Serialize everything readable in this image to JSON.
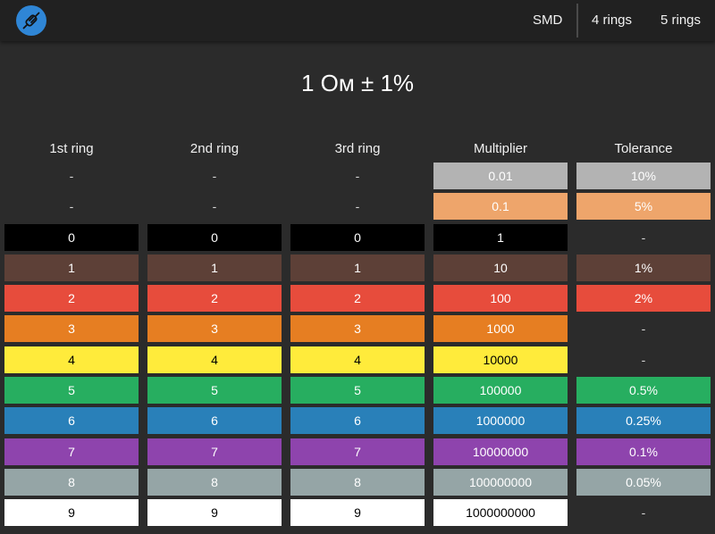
{
  "topbar": {
    "app_icon": "resistor-link-icon",
    "menu": [
      "SMD",
      "4 rings",
      "5 rings"
    ]
  },
  "result": "1 Ом ± 1%",
  "colors": {
    "silver": "#b3b3b3",
    "gold": "#eea56b",
    "black": "#000000",
    "brown": "#5d4037",
    "red": "#e74c3c",
    "orange": "#e67e22",
    "yellow": "#ffeb3b",
    "green": "#27ae60",
    "blue": "#2980b9",
    "violet": "#8e44ad",
    "grey": "#95a5a6",
    "white": "#ffffff"
  },
  "columns": [
    {
      "header": "1st ring",
      "cells": [
        {
          "label": "-",
          "color": null
        },
        {
          "label": "-",
          "color": null
        },
        {
          "label": "0",
          "color": "black"
        },
        {
          "label": "1",
          "color": "brown"
        },
        {
          "label": "2",
          "color": "red"
        },
        {
          "label": "3",
          "color": "orange"
        },
        {
          "label": "4",
          "color": "yellow"
        },
        {
          "label": "5",
          "color": "green"
        },
        {
          "label": "6",
          "color": "blue"
        },
        {
          "label": "7",
          "color": "violet"
        },
        {
          "label": "8",
          "color": "grey"
        },
        {
          "label": "9",
          "color": "white"
        }
      ]
    },
    {
      "header": "2nd ring",
      "cells": [
        {
          "label": "-",
          "color": null
        },
        {
          "label": "-",
          "color": null
        },
        {
          "label": "0",
          "color": "black"
        },
        {
          "label": "1",
          "color": "brown"
        },
        {
          "label": "2",
          "color": "red"
        },
        {
          "label": "3",
          "color": "orange"
        },
        {
          "label": "4",
          "color": "yellow"
        },
        {
          "label": "5",
          "color": "green"
        },
        {
          "label": "6",
          "color": "blue"
        },
        {
          "label": "7",
          "color": "violet"
        },
        {
          "label": "8",
          "color": "grey"
        },
        {
          "label": "9",
          "color": "white"
        }
      ]
    },
    {
      "header": "3rd ring",
      "cells": [
        {
          "label": "-",
          "color": null
        },
        {
          "label": "-",
          "color": null
        },
        {
          "label": "0",
          "color": "black"
        },
        {
          "label": "1",
          "color": "brown"
        },
        {
          "label": "2",
          "color": "red"
        },
        {
          "label": "3",
          "color": "orange"
        },
        {
          "label": "4",
          "color": "yellow"
        },
        {
          "label": "5",
          "color": "green"
        },
        {
          "label": "6",
          "color": "blue"
        },
        {
          "label": "7",
          "color": "violet"
        },
        {
          "label": "8",
          "color": "grey"
        },
        {
          "label": "9",
          "color": "white"
        }
      ]
    },
    {
      "header": "Multiplier",
      "cells": [
        {
          "label": "0.01",
          "color": "silver"
        },
        {
          "label": "0.1",
          "color": "gold"
        },
        {
          "label": "1",
          "color": "black"
        },
        {
          "label": "10",
          "color": "brown"
        },
        {
          "label": "100",
          "color": "red"
        },
        {
          "label": "1000",
          "color": "orange"
        },
        {
          "label": "10000",
          "color": "yellow"
        },
        {
          "label": "100000",
          "color": "green"
        },
        {
          "label": "1000000",
          "color": "blue"
        },
        {
          "label": "10000000",
          "color": "violet"
        },
        {
          "label": "100000000",
          "color": "grey"
        },
        {
          "label": "1000000000",
          "color": "white"
        }
      ]
    },
    {
      "header": "Tolerance",
      "cells": [
        {
          "label": "10%",
          "color": "silver"
        },
        {
          "label": "5%",
          "color": "gold"
        },
        {
          "label": "-",
          "color": null
        },
        {
          "label": "1%",
          "color": "brown"
        },
        {
          "label": "2%",
          "color": "red"
        },
        {
          "label": "-",
          "color": null
        },
        {
          "label": "-",
          "color": null
        },
        {
          "label": "0.5%",
          "color": "green"
        },
        {
          "label": "0.25%",
          "color": "blue"
        },
        {
          "label": "0.1%",
          "color": "violet"
        },
        {
          "label": "0.05%",
          "color": "grey"
        },
        {
          "label": "-",
          "color": null
        }
      ]
    }
  ]
}
